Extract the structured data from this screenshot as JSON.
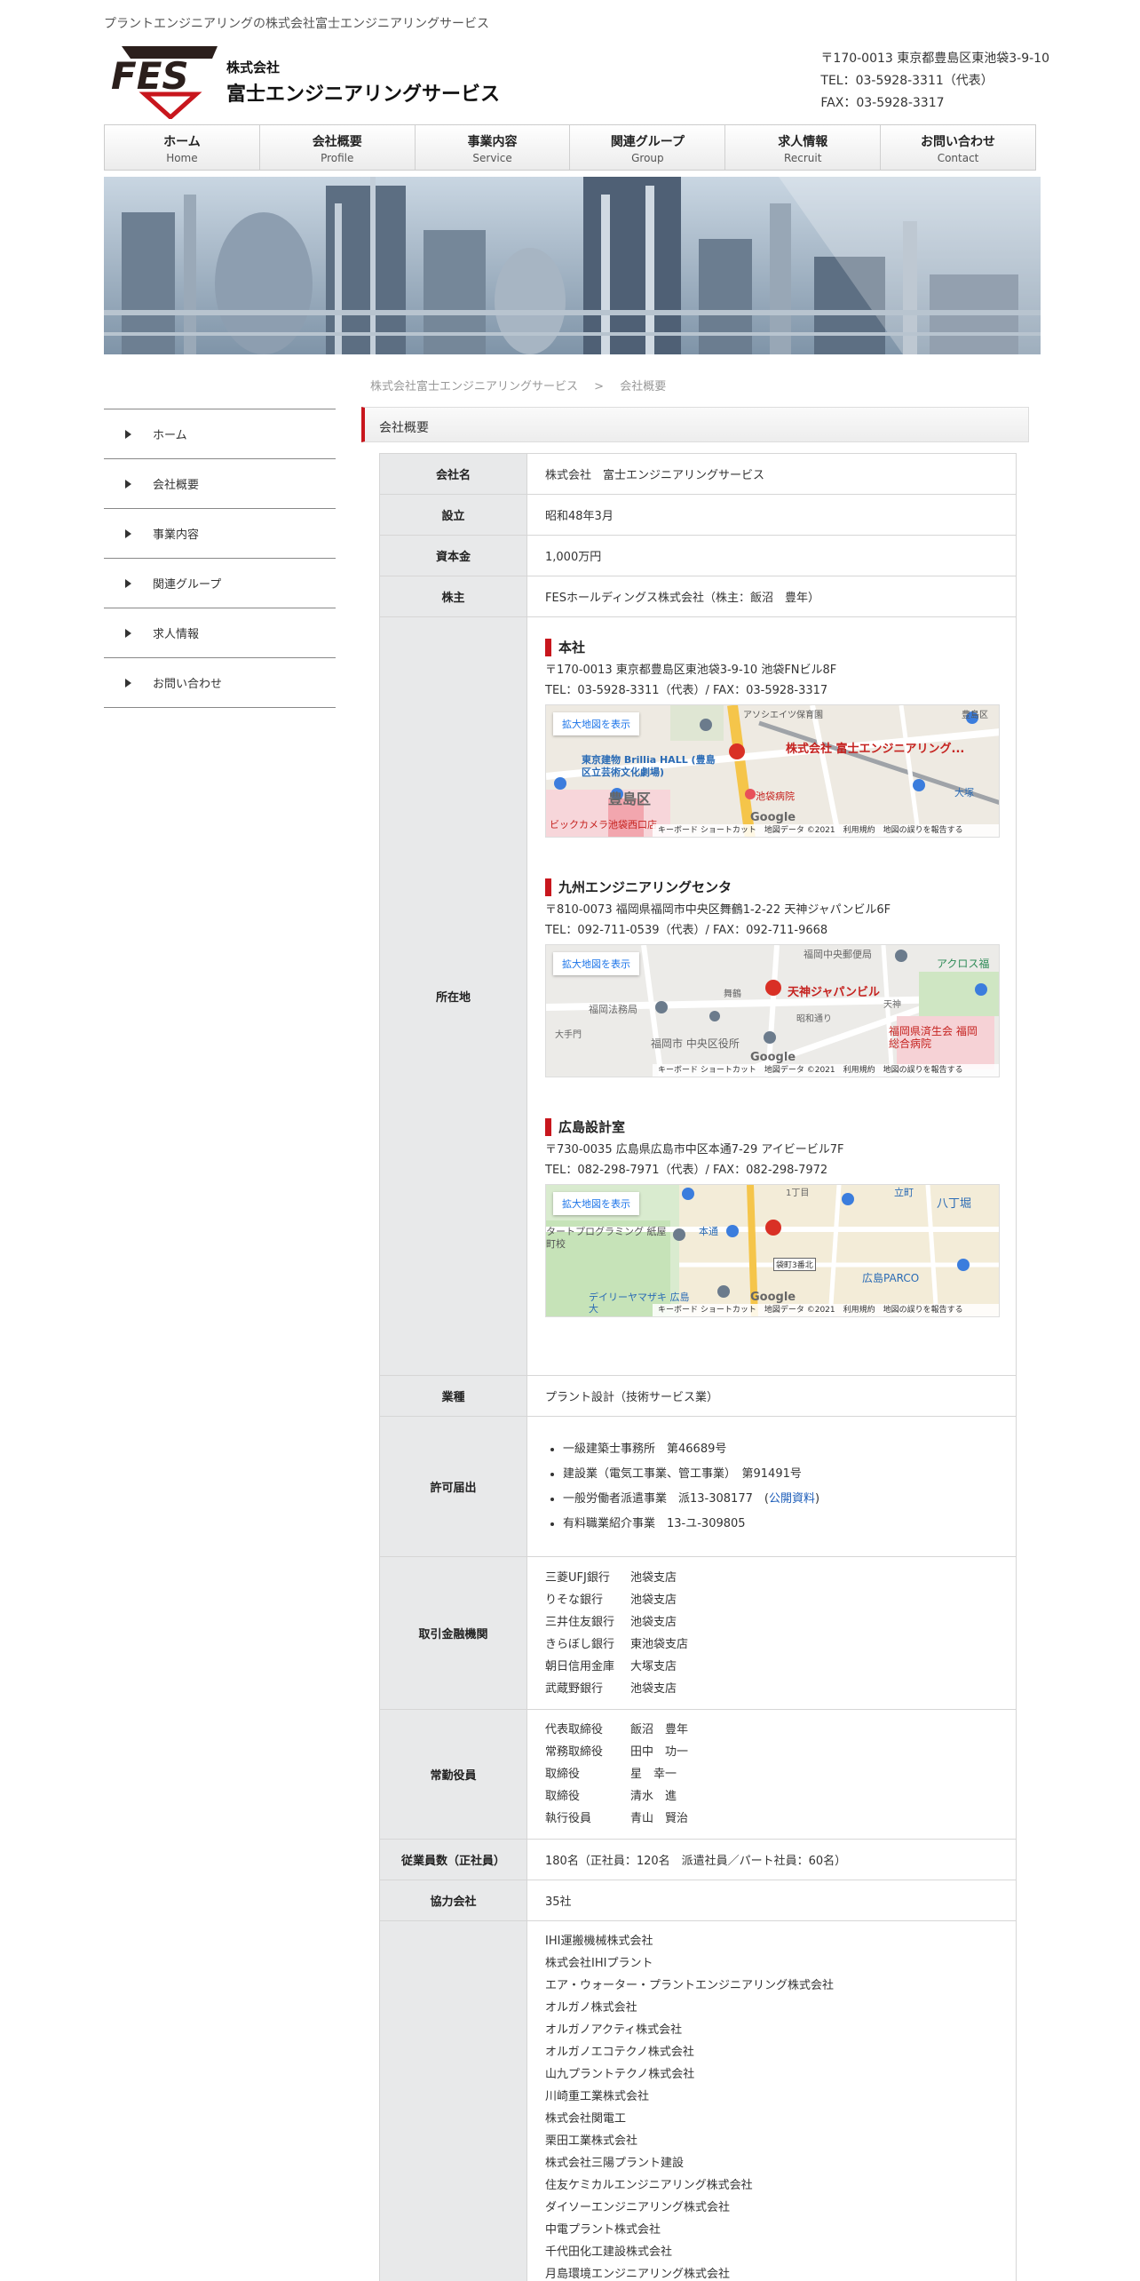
{
  "header": {
    "tagline": "プラントエンジニアリングの株式会社富士エンジニアリングサービス",
    "logo_mark_text": "FES",
    "logo_company_type": "株式会社",
    "logo_company_name": "富士エンジニアリングサービス",
    "address": "〒170-0013 東京都豊島区東池袋3-9-10",
    "tel": "TEL：03-5928-3311（代表）",
    "fax": "FAX：03-5928-3317"
  },
  "global_nav": [
    {
      "jp": "ホーム",
      "en": "Home"
    },
    {
      "jp": "会社概要",
      "en": "Profile"
    },
    {
      "jp": "事業内容",
      "en": "Service"
    },
    {
      "jp": "関連グループ",
      "en": "Group"
    },
    {
      "jp": "求人情報",
      "en": "Recruit"
    },
    {
      "jp": "お問い合わせ",
      "en": "Contact"
    }
  ],
  "breadcrumb": [
    "株式会社富士エンジニアリングサービス",
    ">",
    "会社概要"
  ],
  "sidebar": [
    "ホーム",
    "会社概要",
    "事業内容",
    "関連グループ",
    "求人情報",
    "お問い合わせ"
  ],
  "section_title": "会社概要",
  "table": {
    "company_label": "会社名",
    "company_value": "株式会社　富士エンジニアリングサービス",
    "founded_label": "設立",
    "founded_value": "昭和48年3月",
    "capital_label": "資本金",
    "capital_value": "1,000万円",
    "shareholder_label": "株主",
    "shareholder_value": "FESホールディングス株式会社（株主：飯沼　豊年）",
    "location_label": "所在地",
    "offices": [
      {
        "name": "本社",
        "address": "〒170-0013 東京都豊島区東池袋3-9-10 池袋FNビル8F",
        "tel": "TEL：03-5928-3311（代表）/ FAX：03-5928-3317",
        "map_button": "拡大地図を表示",
        "map_pin": "株式会社 富士エンジニアリング...",
        "map_labels": [
          "東京建物 Brillia HALL (豊島区立芸術文化劇場)",
          "豊島区",
          "池袋病院",
          "アソシエイツ保育園",
          "豊島区",
          "大塚",
          "ビックカメラ池袋西口店"
        ]
      },
      {
        "name": "九州エンジニアリングセンタ",
        "address": "〒810-0073 福岡県福岡市中央区舞鶴1-2-22 天神ジャパンビル6F",
        "tel": "TEL：092-711-0539（代表）/ FAX：092-711-9668",
        "map_button": "拡大地図を表示",
        "map_pin": "天神ジャパンビル",
        "map_labels": [
          "福岡中央郵便局",
          "アクロス福",
          "福岡法務局",
          "舞鶴",
          "昭和通り",
          "天神",
          "福岡市 中央区役所",
          "福岡県済生会 福岡総合病院",
          "大手門"
        ]
      },
      {
        "name": "広島設計室",
        "address": "〒730-0035 広島県広島市中区本通7-29 アイビービル7F",
        "tel": "TEL：082-298-7971（代表）/ FAX：082-298-7972",
        "map_button": "拡大地図を表示",
        "map_pin": "",
        "map_labels": [
          "タートプログラミング 紙屋町校",
          "本通",
          "袋町3番北",
          "広島PARCO",
          "立町",
          "八丁堀",
          "デイリーヤマザキ 広島大",
          "1丁目"
        ]
      }
    ],
    "map_footer": "キーボード ショートカット　地図データ ©2021　利用規約　地図の誤りを報告する",
    "map_google": "Google",
    "business_label": "業種",
    "business_value": "プラント設計（技術サービス業）",
    "permits_label": "許可届出",
    "permits": [
      "一級建築士事務所　第46689号",
      "建設業（電気工事業、管工事業）　第91491号",
      "一般労働者派遣事業　派13-308177",
      "有料職業紹介事業　13-ユ-309805"
    ],
    "permit_link": "公開資料",
    "banks_label": "取引金融機関",
    "banks": [
      {
        "bank": "三菱UFJ銀行",
        "branch": "池袋支店"
      },
      {
        "bank": "りそな銀行",
        "branch": "池袋支店"
      },
      {
        "bank": "三井住友銀行",
        "branch": "池袋支店"
      },
      {
        "bank": "きらぼし銀行",
        "branch": "東池袋支店"
      },
      {
        "bank": "朝日信用金庫",
        "branch": "大塚支店"
      },
      {
        "bank": "武蔵野銀行",
        "branch": "池袋支店"
      }
    ],
    "officers_label": "常勤役員",
    "officers": [
      {
        "title": "代表取締役",
        "name": "飯沼　豊年"
      },
      {
        "title": "常務取締役",
        "name": "田中　功一"
      },
      {
        "title": "取締役",
        "name": "星　幸一"
      },
      {
        "title": "取締役",
        "name": "清水　進"
      },
      {
        "title": "執行役員",
        "name": "青山　賢治"
      }
    ],
    "employees_label": "従業員数（正社員）",
    "employees_value": "180名（正社員：120名　派遣社員／パート社員：60名）",
    "partners_label": "協力会社",
    "partners_value": "35社",
    "clients": [
      "IHI運搬機械株式会社",
      "株式会社IHIプラント",
      "エア・ウォーター・プラントエンジニアリング株式会社",
      "オルガノ株式会社",
      "オルガノアクティ株式会社",
      "オルガノエコテクノ株式会社",
      "山九プラントテクノ株式会社",
      "川崎重工業株式会社",
      "株式会社関電工",
      "栗田工業株式会社",
      "株式会社三陽プラント建設",
      "住友ケミカルエンジニアリング株式会社",
      "ダイソーエンジニアリング株式会社",
      "中電プラント株式会社",
      "千代田化工建設株式会社",
      "月島環境エンジニアリング株式会社"
    ]
  },
  "colors": {
    "accent": "#c8161d",
    "link": "#1a5bb8",
    "th_bg": "#e8e9ea"
  }
}
